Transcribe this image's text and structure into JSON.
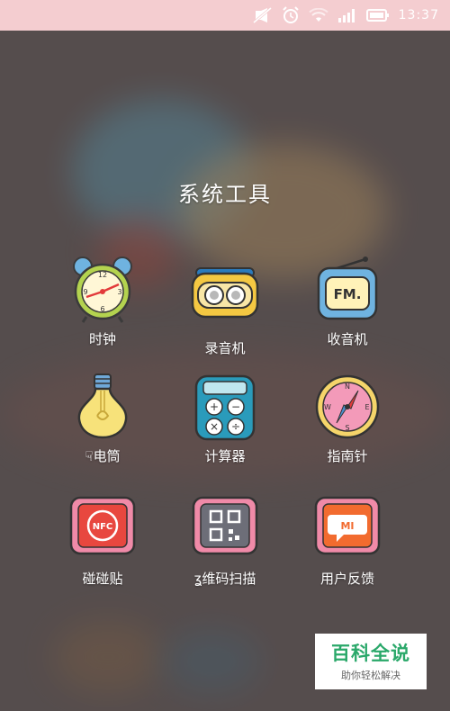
{
  "status_bar": {
    "time": "13:37",
    "icons": [
      "mute-icon",
      "alarm-icon",
      "wifi-icon",
      "signal-icon",
      "battery-icon"
    ]
  },
  "folder": {
    "title": "系统工具",
    "apps": [
      {
        "label": "时钟",
        "icon": "alarm-clock-icon"
      },
      {
        "label": "录音机",
        "icon": "recorder-icon"
      },
      {
        "label": "收音机",
        "icon": "radio-icon"
      },
      {
        "label": "电筒",
        "icon": "lightbulb-icon"
      },
      {
        "label": "计算器",
        "icon": "calculator-icon"
      },
      {
        "label": "指南针",
        "icon": "compass-icon"
      },
      {
        "label": "碰碰贴",
        "icon": "nfc-icon"
      },
      {
        "label": "维码扫描",
        "icon": "qr-code-icon"
      },
      {
        "label": "用户反馈",
        "icon": "mi-feedback-icon"
      }
    ],
    "icon_texts": {
      "radio": "FM.",
      "nfc": "NFC",
      "mi": "MI"
    }
  },
  "watermark": {
    "title": "百科全说",
    "subtitle": "助你轻松解决"
  }
}
